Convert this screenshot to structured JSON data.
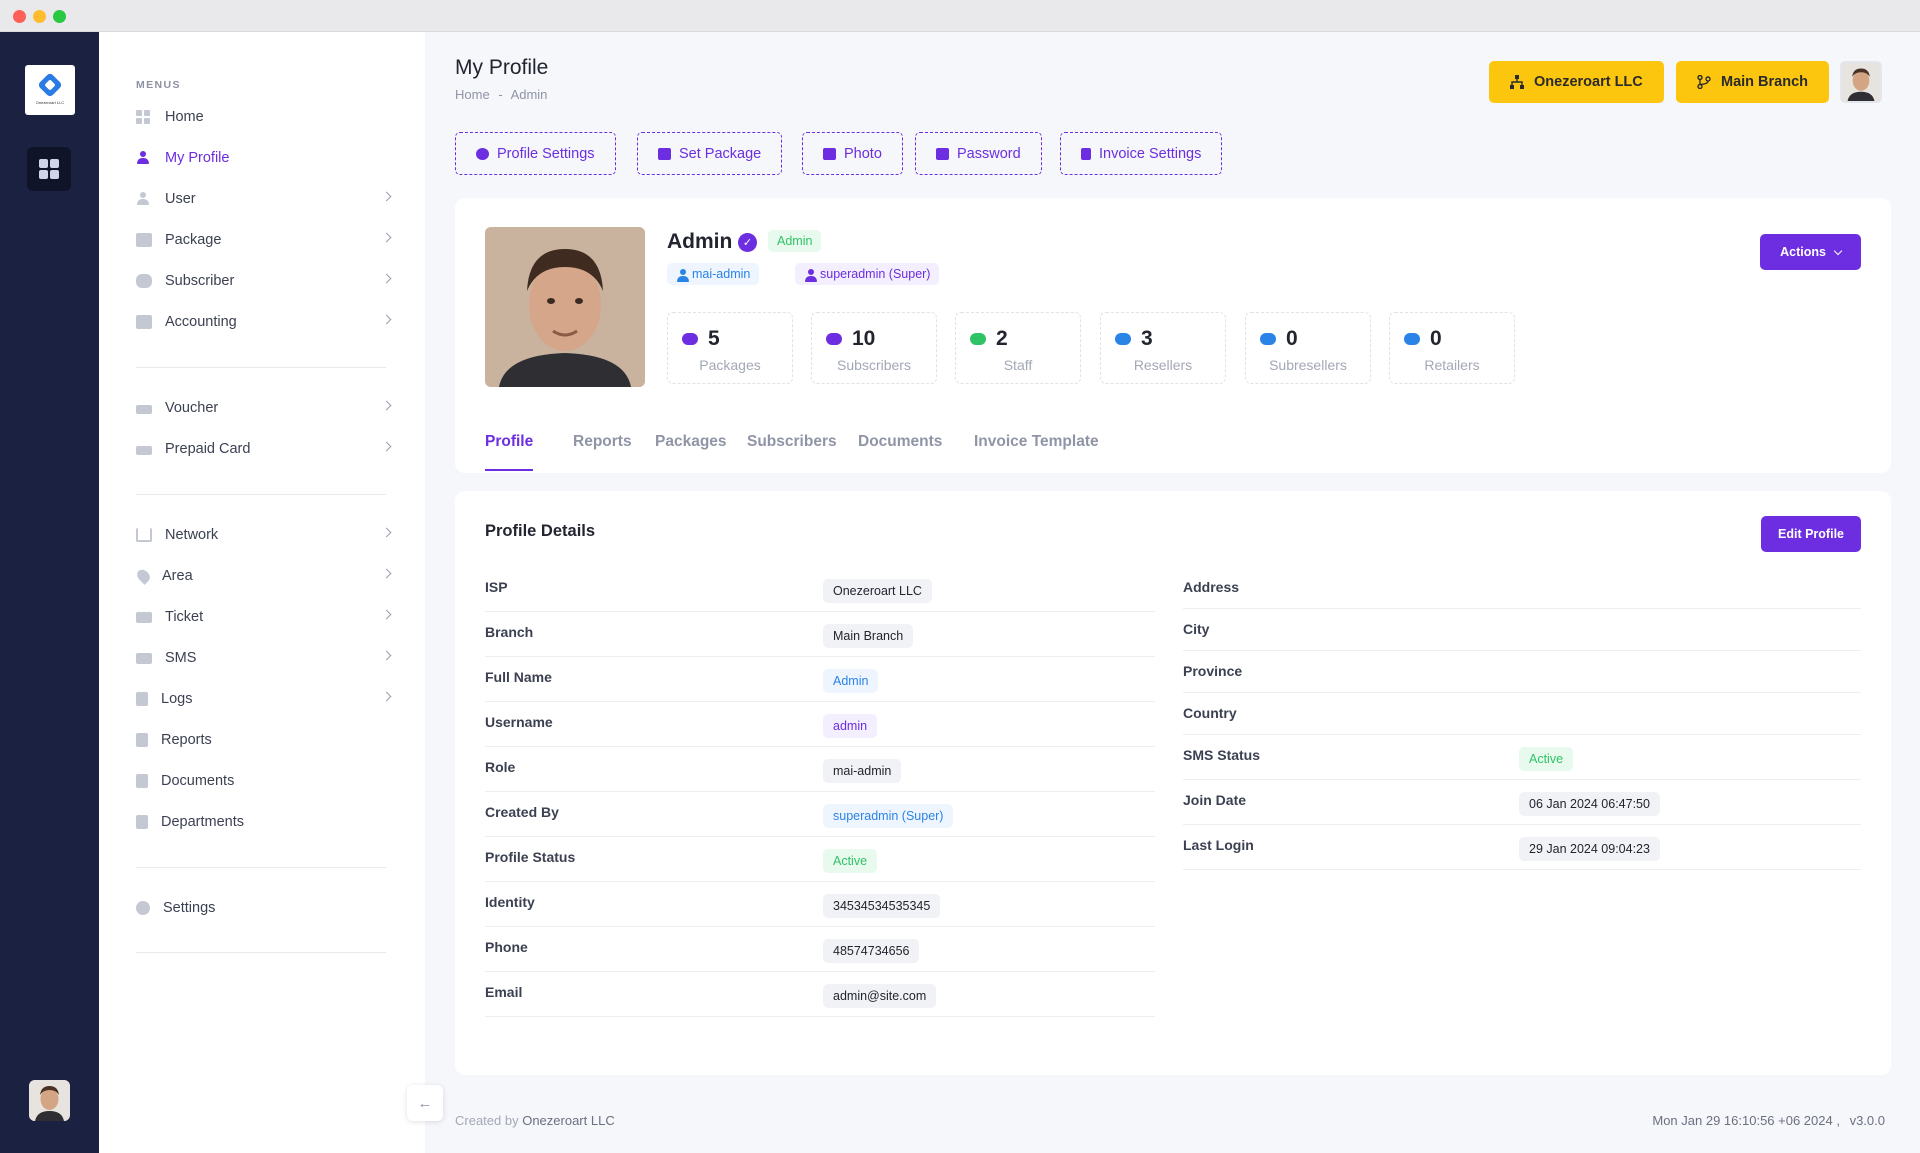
{
  "sidebar": {
    "menus_label": "MENUS",
    "items": [
      {
        "label": "Home",
        "icon": "home-icon"
      },
      {
        "label": "My Profile",
        "icon": "user-icon"
      },
      {
        "label": "User",
        "icon": "user-icon"
      },
      {
        "label": "Package",
        "icon": "package-icon"
      },
      {
        "label": "Subscriber",
        "icon": "users-icon"
      },
      {
        "label": "Accounting",
        "icon": "calculator-icon"
      },
      {
        "label": "Voucher",
        "icon": "voucher-icon"
      },
      {
        "label": "Prepaid Card",
        "icon": "card-icon"
      },
      {
        "label": "Network",
        "icon": "network-icon"
      },
      {
        "label": "Area",
        "icon": "map-pin-icon"
      },
      {
        "label": "Ticket",
        "icon": "ticket-icon"
      },
      {
        "label": "SMS",
        "icon": "message-icon"
      },
      {
        "label": "Logs",
        "icon": "book-icon"
      },
      {
        "label": "Reports",
        "icon": "report-icon"
      },
      {
        "label": "Documents",
        "icon": "document-icon"
      },
      {
        "label": "Departments",
        "icon": "building-icon"
      },
      {
        "label": "Settings",
        "icon": "gear-icon"
      }
    ]
  },
  "rail": {
    "logo_text": "Onezeroart LLC"
  },
  "header": {
    "title": "My Profile",
    "breadcrumb_home": "Home",
    "breadcrumb_sep": "-",
    "breadcrumb_current": "Admin",
    "company_button": "Onezeroart LLC",
    "branch_button": "Main Branch"
  },
  "toolbar": {
    "profile_settings": "Profile Settings",
    "set_package": "Set Package",
    "photo": "Photo",
    "password": "Password",
    "invoice_settings": "Invoice Settings"
  },
  "profile": {
    "name": "Admin",
    "role_badge": "Admin",
    "username_badge": "mai-admin",
    "creator_badge": "superadmin (Super)",
    "actions_label": "Actions",
    "stats": [
      {
        "value": "5",
        "label": "Packages"
      },
      {
        "value": "10",
        "label": "Subscribers"
      },
      {
        "value": "2",
        "label": "Staff"
      },
      {
        "value": "3",
        "label": "Resellers"
      },
      {
        "value": "0",
        "label": "Subresellers"
      },
      {
        "value": "0",
        "label": "Retailers"
      }
    ],
    "tabs": [
      "Profile",
      "Reports",
      "Packages",
      "Subscribers",
      "Documents",
      "Invoice Template"
    ]
  },
  "details": {
    "title": "Profile Details",
    "edit_label": "Edit Profile",
    "left": [
      {
        "label": "ISP",
        "value": "Onezeroart LLC"
      },
      {
        "label": "Branch",
        "value": "Main Branch"
      },
      {
        "label": "Full Name",
        "value": "Admin"
      },
      {
        "label": "Username",
        "value": "admin"
      },
      {
        "label": "Role",
        "value": "mai-admin"
      },
      {
        "label": "Created By",
        "value": "superadmin (Super)"
      },
      {
        "label": "Profile Status",
        "value": "Active"
      },
      {
        "label": "Identity",
        "value": "34534534535345"
      },
      {
        "label": "Phone",
        "value": "48574734656"
      },
      {
        "label": "Email",
        "value": "admin@site.com"
      }
    ],
    "right": [
      {
        "label": "Address",
        "value": ""
      },
      {
        "label": "City",
        "value": ""
      },
      {
        "label": "Province",
        "value": ""
      },
      {
        "label": "Country",
        "value": ""
      },
      {
        "label": "SMS Status",
        "value": "Active"
      },
      {
        "label": "Join Date",
        "value": "06 Jan 2024 06:47:50"
      },
      {
        "label": "Last Login",
        "value": "29 Jan 2024 09:04:23"
      }
    ]
  },
  "footer": {
    "created_by": "Created by",
    "company": "Onezeroart LLC",
    "timestamp": "Mon Jan 29 16:10:56 +06 2024 ,",
    "version": "v3.0.0"
  },
  "colors": {
    "accent": "#6c2ee0",
    "warning": "#fcc60e",
    "success": "#2fc365",
    "info": "#2a84e5",
    "rail": "#1b2140"
  }
}
